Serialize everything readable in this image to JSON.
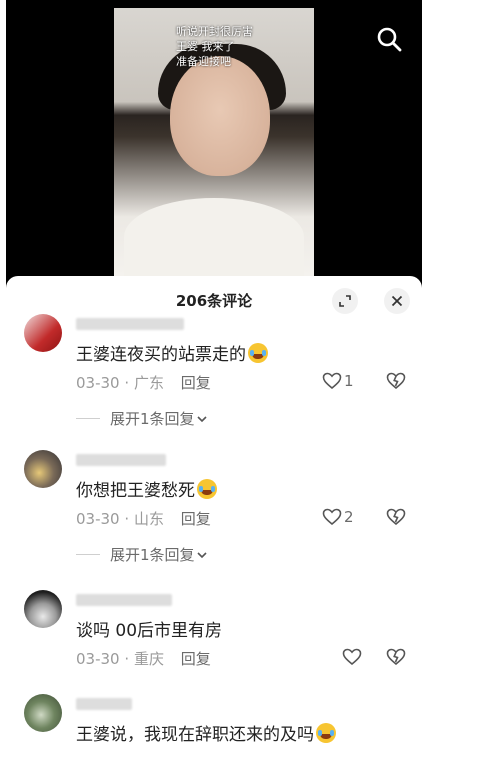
{
  "video": {
    "caption_lines": [
      "听说开封很厉害",
      "王婆 我来了",
      "准备迎接吧"
    ]
  },
  "sheet": {
    "title": "206条评论"
  },
  "comments": [
    {
      "text": "王婆连夜买的站票走的",
      "emoji": "crying-laughing-emoji",
      "date": "03-30",
      "location": "广东",
      "reply": "回复",
      "likes": "1",
      "expand": "展开1条回复"
    },
    {
      "text": "你想把王婆愁死",
      "emoji": "rofl-emoji",
      "date": "03-30",
      "location": "山东",
      "reply": "回复",
      "likes": "2",
      "expand": "展开1条回复"
    },
    {
      "text": "谈吗 00后市里有房",
      "emoji": "",
      "date": "03-30",
      "location": "重庆",
      "reply": "回复",
      "likes": "",
      "expand": ""
    },
    {
      "text": "王婆说，我现在辞职还来的及吗",
      "emoji": "rofl-emoji",
      "date": "",
      "location": "",
      "reply": "",
      "likes": "",
      "expand": ""
    }
  ],
  "meta_separator": "·",
  "colors": {
    "sheet_bg": "#ffffff",
    "meta_gray": "#9a9a9a",
    "text_dark": "#222222"
  }
}
